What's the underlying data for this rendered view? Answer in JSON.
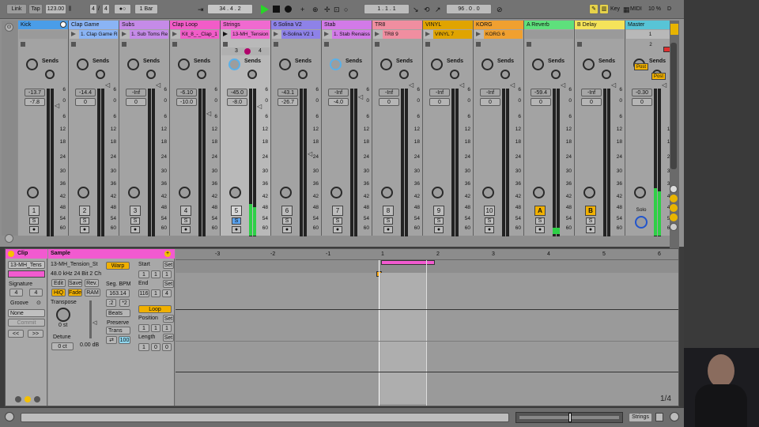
{
  "transport": {
    "link": "Link",
    "tap": "Tap",
    "tempo": "123.00",
    "sig_num": "4",
    "sig_den": "4",
    "metro": "●○",
    "quant": "1 Bar",
    "position": "34 . 4 . 2",
    "loop_start": "1 . 1 . 1",
    "loop_len": "96 . 0 . 0",
    "key": "Key",
    "midi": "MIDI",
    "cpu": "10 %",
    "disk": "D"
  },
  "tracks": [
    {
      "name": "Kick",
      "color": "#4a9de8",
      "clip": "",
      "vol": "-13.7",
      "peak": "-7.8",
      "num": "1",
      "sel": false
    },
    {
      "name": "Clap Game",
      "color": "#8ab4f5",
      "clip": "1. Clap Game Re",
      "vol": "-14.4",
      "peak": "0",
      "num": "2",
      "sel": false
    },
    {
      "name": "Subs",
      "color": "#c58be8",
      "clip": "1. Sub Toms Re",
      "vol": "-Inf",
      "peak": "0",
      "num": "3",
      "sel": false
    },
    {
      "name": "Clap Loop",
      "color": "#f25cc8",
      "clip": "Kit_8_-_Clap_1",
      "vol": "-6.10",
      "peak": "-10.0",
      "num": "4",
      "sel": false
    },
    {
      "name": "Strings",
      "color": "#f06ad0",
      "clip": "13-MH_Tension",
      "vol": "-45.0",
      "peak": "-8.0",
      "num": "5",
      "sel": true
    },
    {
      "name": "6 Solina V2",
      "color": "#8e82e8",
      "clip": "6-Solina V2 1",
      "vol": "-43.1",
      "peak": "-26.7",
      "num": "6",
      "sel": false
    },
    {
      "name": "Stab",
      "color": "#d27ae8",
      "clip": "1. Stab Renaiss",
      "vol": "-Inf",
      "peak": "-4.0",
      "num": "7",
      "sel": false
    },
    {
      "name": "TR8",
      "color": "#f08ea0",
      "clip": "TR8 9",
      "vol": "-Inf",
      "peak": "0",
      "num": "8",
      "sel": false
    },
    {
      "name": "VINYL",
      "color": "#e0a400",
      "clip": "VINYL 7",
      "vol": "-Inf",
      "peak": "0",
      "num": "9",
      "sel": false
    },
    {
      "name": "KORG",
      "color": "#f0a030",
      "clip": "KORG 6",
      "vol": "-Inf",
      "peak": "0",
      "num": "10",
      "sel": false
    },
    {
      "name": "A Reverb",
      "color": "#5ee07c",
      "clip": "",
      "vol": "-59.4",
      "peak": "0",
      "num": "A",
      "sel": false
    },
    {
      "name": "B Delay",
      "color": "#f5e35a",
      "clip": "",
      "vol": "-Inf",
      "peak": "0",
      "num": "B",
      "sel": false
    },
    {
      "name": "Master",
      "color": "#58c4d6",
      "clip": "",
      "vol": "-0.30",
      "peak": "0",
      "num": "",
      "sel": false
    }
  ],
  "mixer": {
    "sends_label": "Sends",
    "ticks": [
      "6",
      "0",
      "6",
      "12",
      "18",
      "24",
      "30",
      "36",
      "42",
      "48",
      "54",
      "60"
    ],
    "strings_scene": [
      "3",
      "4"
    ],
    "master_slot": "1",
    "master_slot2": "2",
    "post": "Post",
    "solo": "Solo"
  },
  "clip": {
    "title": "Clip",
    "name": "13-MH_Tens",
    "signature": "Signature",
    "sig_num": "4",
    "sig_den": "4",
    "groove": "Groove",
    "groove_val": "None",
    "commit": "Commit",
    "nav_prev": "<<",
    "nav_next": ">>"
  },
  "sample": {
    "title": "Sample",
    "file": "13-MH_Tension_St",
    "info": "48.0 kHz 24 Bit 2 Ch",
    "edit": "Edit",
    "save": "Save",
    "rev": "Rev.",
    "hiq": "HiQ",
    "fade": "Fade",
    "ram": "RAM",
    "transpose": "Transpose",
    "transpose_val": "0 st",
    "detune": "Detune",
    "detune_val": "0 ct",
    "gain": "0.00 dB",
    "warp": "Warp",
    "segbpm_label": "Seg. BPM",
    "segbpm": "163.14",
    "half": ":2",
    "double": "*2",
    "mode": "Beats",
    "preserve_label": "Preserve",
    "preserve": "Trans",
    "grain": "100",
    "start": "Start",
    "set": "Set",
    "end": "End",
    "loop": "Loop",
    "position": "Position",
    "length": "Length",
    "start_vals": [
      "1",
      "1",
      "1"
    ],
    "end_vals": [
      "116",
      "1",
      "4"
    ],
    "pos_vals": [
      "1",
      "1",
      "1"
    ],
    "len_vals": [
      "1",
      "0",
      "0"
    ]
  },
  "ruler": {
    "marks": [
      "-3",
      "-2",
      "-1",
      "1",
      "2",
      "3",
      "4",
      "5",
      "6"
    ]
  },
  "waveform": {
    "page": "1/4"
  },
  "bottom": {
    "track": "Strings"
  }
}
